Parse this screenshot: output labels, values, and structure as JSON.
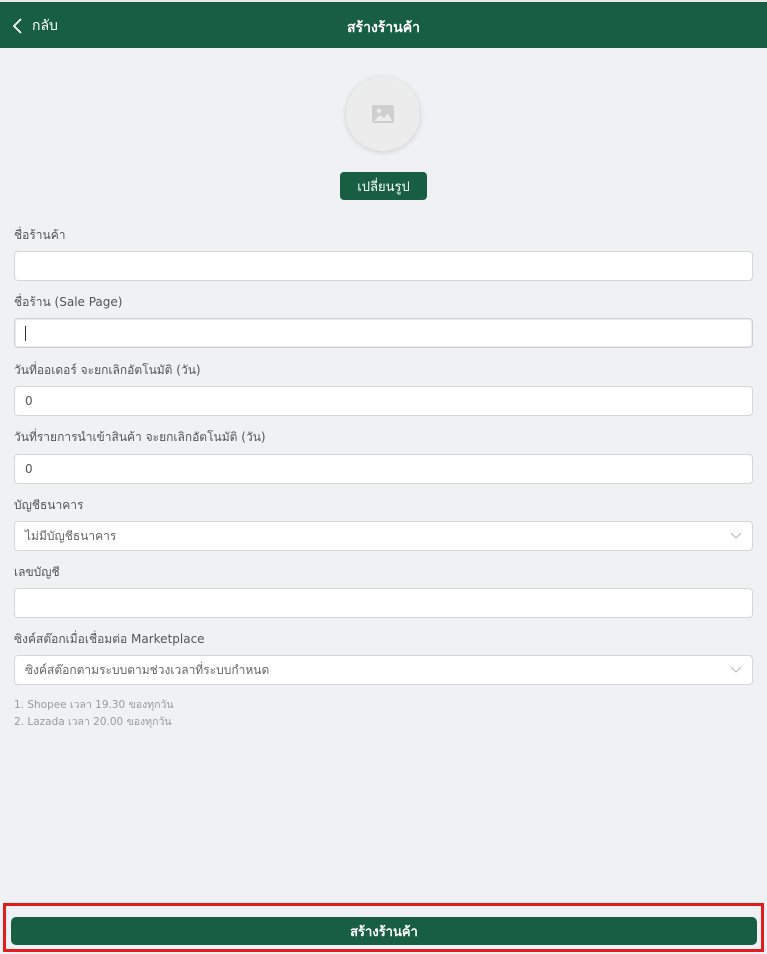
{
  "header": {
    "back_label": "กลับ",
    "title": "สร้างร้านค้า"
  },
  "image": {
    "change_label": "เปลี่ยนรูป"
  },
  "form": {
    "store_name": {
      "label": "ชื่อร้านค้า",
      "value": ""
    },
    "sale_page": {
      "label": "ชื่อร้าน (Sale Page)",
      "value": ""
    },
    "order_cancel_days": {
      "label": "วันที่ออเดอร์ จะยกเลิกอัตโนมัติ (วัน)",
      "value": "0"
    },
    "import_cancel_days": {
      "label": "วันที่รายการนำเข้าสินค้า จะยกเลิกอัตโนมัติ (วัน)",
      "value": "0"
    },
    "bank_account": {
      "label": "บัญชีธนาคาร",
      "value": "ไม่มีบัญชีธนาคาร"
    },
    "account_number": {
      "label": "เลขบัญชี",
      "value": ""
    },
    "stock_sync": {
      "label": "ซิงค์สต๊อกเมื่อเชื่อมต่อ Marketplace",
      "value": "ซิงค์สต๊อกตามระบบตามช่วงเวลาที่ระบบกำหนด"
    },
    "notes": [
      "1. Shopee เวลา 19.30 ของทุกวัน",
      "2. Lazada เวลา 20.00 ของทุกวัน"
    ]
  },
  "footer": {
    "submit_label": "สร้างร้านค้า"
  },
  "colors": {
    "brand": "#175e42",
    "highlight": "#e11d1d"
  }
}
